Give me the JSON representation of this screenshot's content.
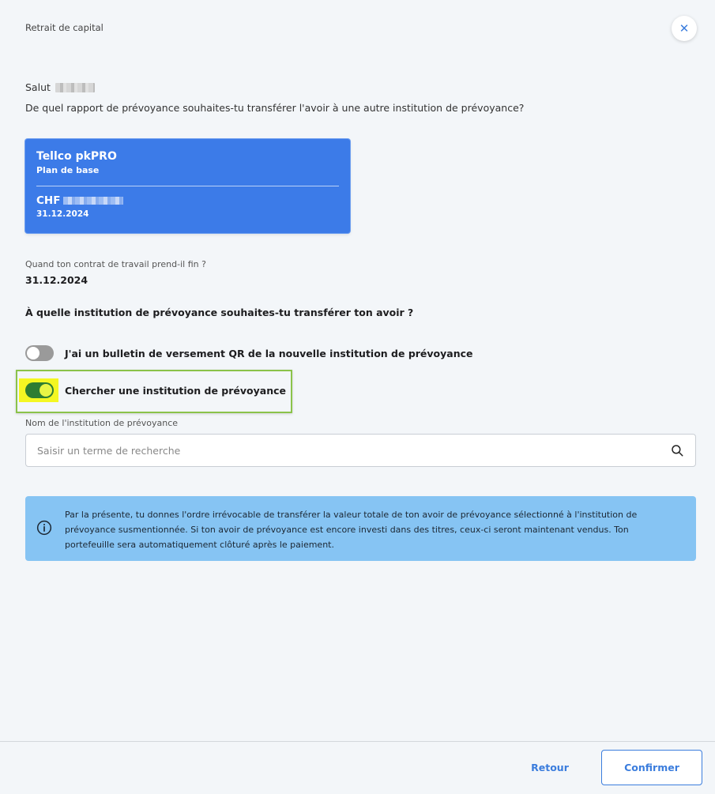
{
  "header": {
    "title": "Retrait de capital"
  },
  "greeting": {
    "text": "Salut"
  },
  "question_report": "De quel rapport de prévoyance souhaites-tu transférer l'avoir à une autre institution de prévoyance?",
  "plan_card": {
    "name": "Tellco pkPRO",
    "subtitle": "Plan de base",
    "currency": "CHF",
    "date": "31.12.2024"
  },
  "contract": {
    "label": "Quand ton contrat de travail prend-il fin ?",
    "value": "31.12.2024"
  },
  "question_institution": "À quelle institution de prévoyance souhaites-tu transférer ton avoir ?",
  "toggles": [
    {
      "label": "J'ai un bulletin de versement QR de la nouvelle institution de prévoyance",
      "checked": false
    },
    {
      "label": "Chercher une institution de prévoyance",
      "checked": true
    }
  ],
  "search": {
    "label": "Nom de l'institution de prévoyance",
    "placeholder": "Saisir un terme de recherche",
    "value": ""
  },
  "info": {
    "text": "Par la présente, tu donnes l'ordre irrévocable de transférer la valeur totale de ton avoir de prévoyance sélectionné à l'institution de prévoyance susmentionnée. Si ton avoir de prévoyance est encore investi dans des titres, ceux-ci seront maintenant vendus. Ton portefeuille sera automatiquement clôturé après le paiement."
  },
  "footer": {
    "back_label": "Retour",
    "confirm_label": "Confirmer"
  },
  "colors": {
    "accent": "#3b7ddd",
    "card": "#3c7be8",
    "toggle_on": "#2e7d32",
    "info_bg": "#86c4f3"
  }
}
